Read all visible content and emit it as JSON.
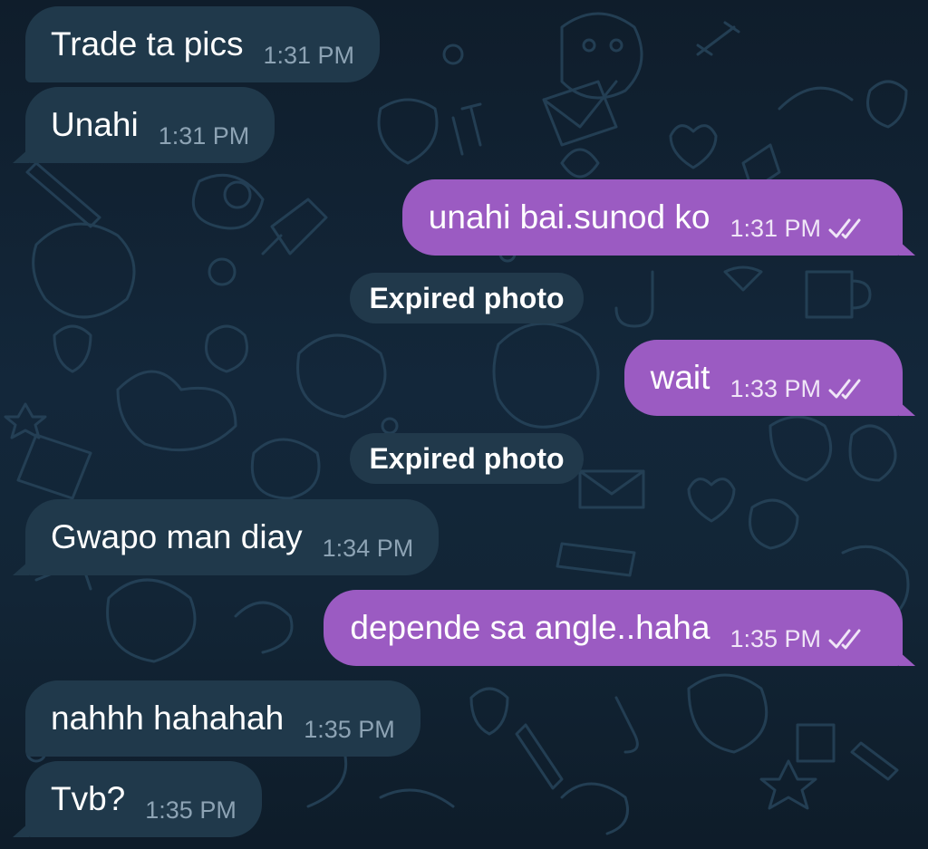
{
  "colors": {
    "background": "#13273a",
    "incoming_bubble": "#20394b",
    "outgoing_bubble": "#9b5bc2",
    "incoming_time": "#8da3b4",
    "outgoing_time": "#f0e6f7",
    "service_pill": "#21394b"
  },
  "messages": [
    {
      "direction": "incoming",
      "text": "Trade ta pics",
      "time": "1:31 PM"
    },
    {
      "direction": "incoming",
      "text": "Unahi",
      "time": "1:31 PM"
    },
    {
      "direction": "outgoing",
      "text": "unahi bai.sunod ko",
      "time": "1:31 PM",
      "status_icon": "double-check-icon"
    },
    {
      "direction": "service",
      "text": "Expired photo"
    },
    {
      "direction": "outgoing",
      "text": "wait",
      "time": "1:33 PM",
      "status_icon": "double-check-icon"
    },
    {
      "direction": "service",
      "text": "Expired photo"
    },
    {
      "direction": "incoming",
      "text": "Gwapo man diay",
      "time": "1:34 PM"
    },
    {
      "direction": "outgoing",
      "text": "depende sa angle..haha",
      "time": "1:35 PM",
      "status_icon": "double-check-icon"
    },
    {
      "direction": "incoming",
      "text": "nahhh hahahah",
      "time": "1:35 PM"
    },
    {
      "direction": "incoming",
      "text": "Tvb?",
      "time": "1:35 PM"
    }
  ]
}
